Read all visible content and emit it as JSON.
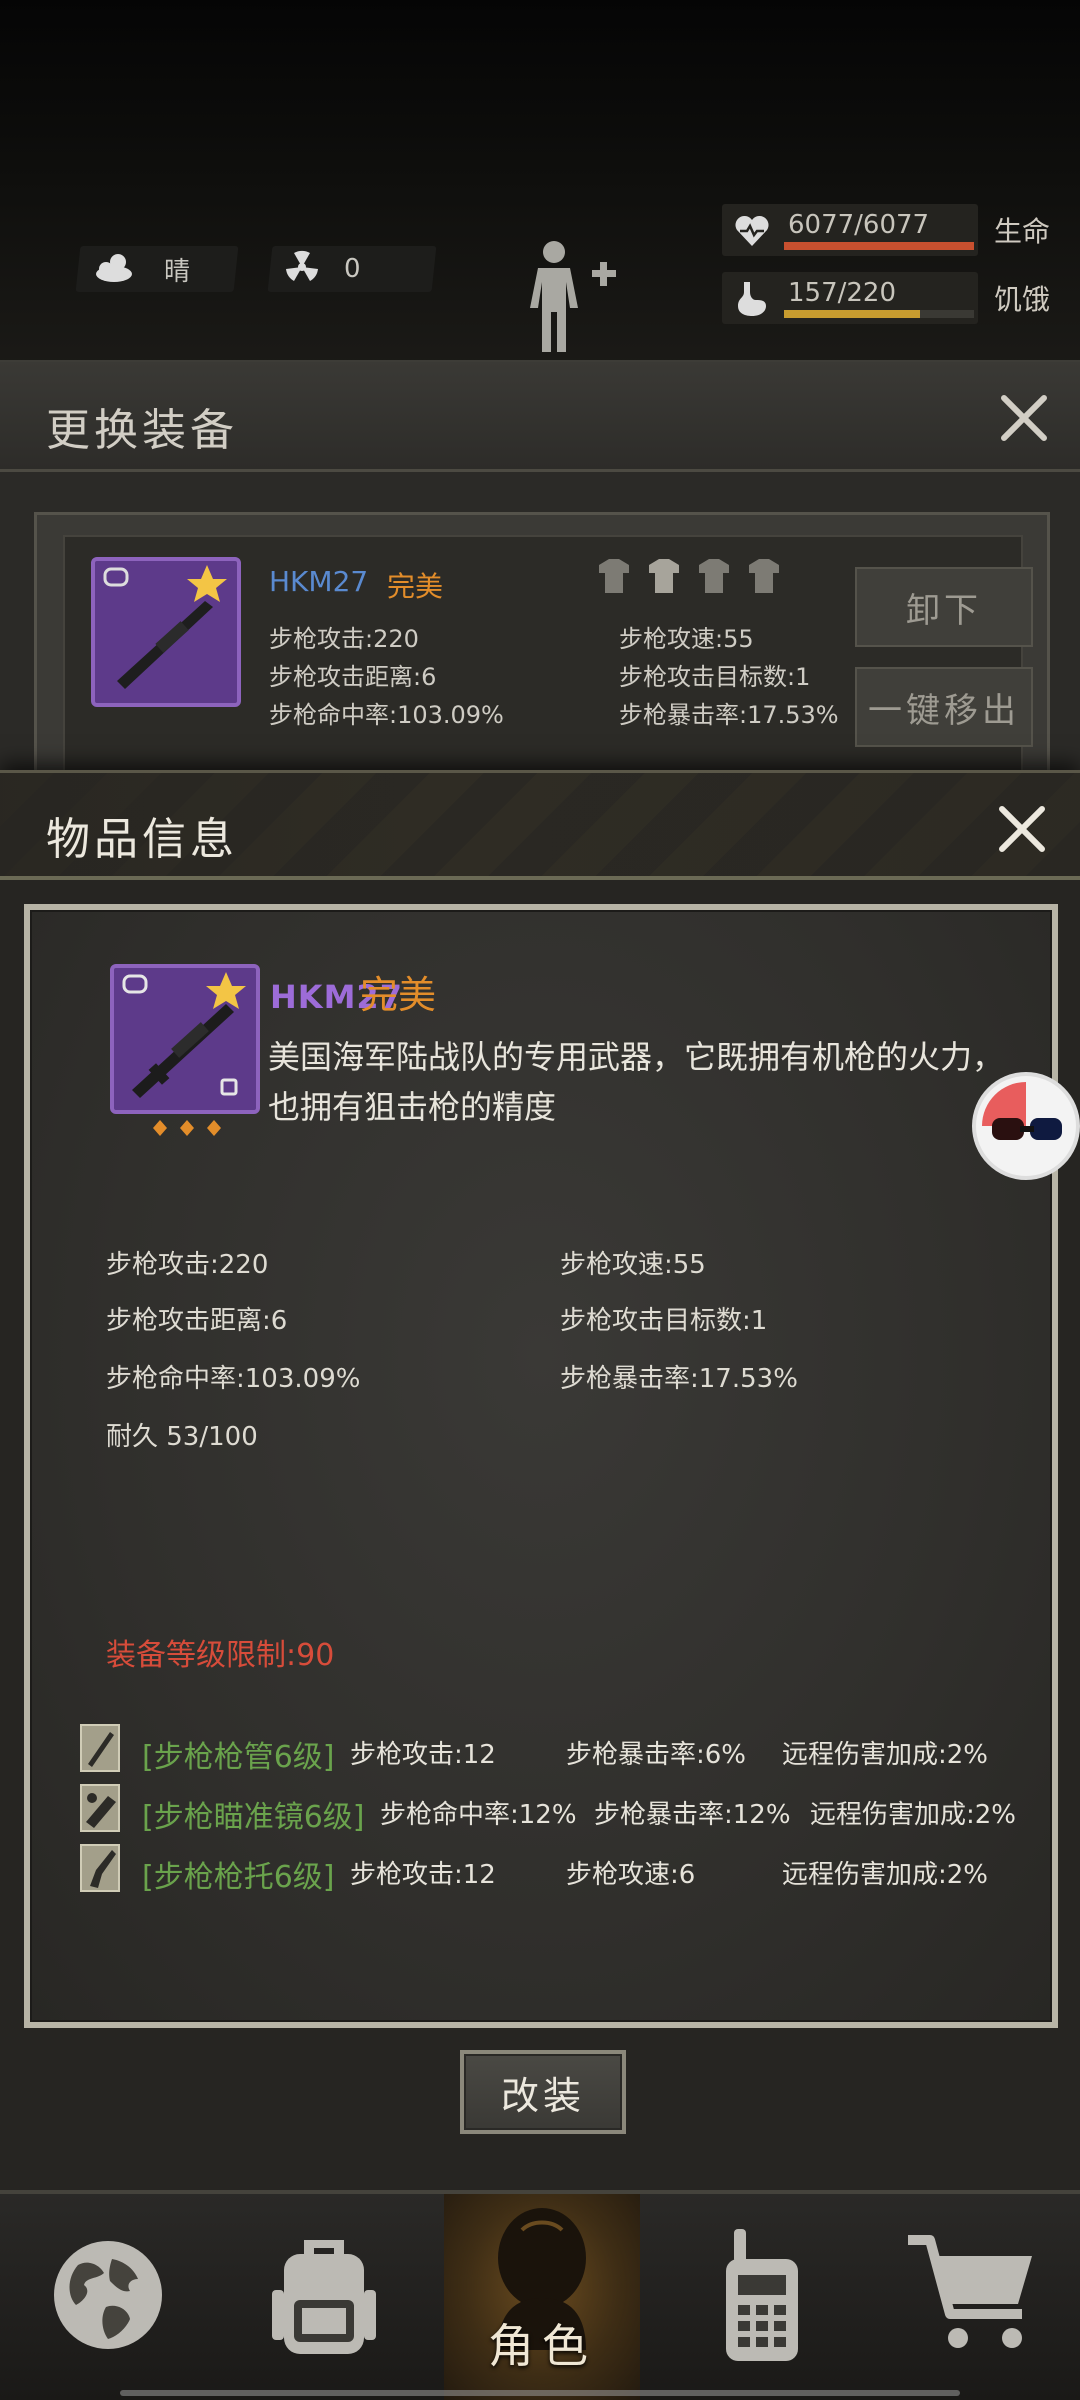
{
  "hud": {
    "weather": "晴",
    "radiation": "0",
    "health": {
      "value": "6077/6077",
      "label": "生命",
      "fill": 1.0,
      "color": "#c8502f"
    },
    "hunger": {
      "value": "157/220",
      "label": "饥饿",
      "fill": 0.714,
      "color": "#c89c2f"
    }
  },
  "equip_panel": {
    "title": "更换装备",
    "item_name": "HKM27",
    "item_quality": "完美",
    "stats": [
      "步枪攻击:220",
      "步枪攻速:55",
      "步枪攻击距离:6",
      "步枪攻击目标数:1",
      "步枪命中率:103.09%",
      "步枪暴击率:17.53%"
    ],
    "unequip_label": "卸下",
    "remove_all_label": "一键移出"
  },
  "modal": {
    "title": "物品信息",
    "item": {
      "name": "HKM27",
      "quality": "完美",
      "description": "美国海军陆战队的专用武器，它既拥有机枪的火力，也拥有狙击枪的精度"
    },
    "stats": {
      "attack": "步枪攻击:220",
      "speed": "步枪攻速:55",
      "range": "步枪攻击距离:6",
      "targets": "步枪攻击目标数:1",
      "accuracy": "步枪命中率:103.09%",
      "crit": "步枪暴击率:17.53%",
      "durability": "耐久 53/100"
    },
    "level_limit": "装备等级限制:90",
    "mods": [
      {
        "name": "[步枪枪管6级]",
        "stats": [
          "步枪攻击:12",
          "步枪暴击率:6%",
          "远程伤害加成:2%"
        ]
      },
      {
        "name": "[步枪瞄准镜6级]",
        "stats": [
          "步枪命中率:12%",
          "步枪暴击率:12%",
          "远程伤害加成:2%"
        ]
      },
      {
        "name": "[步枪枪托6级]",
        "stats": [
          "步枪攻击:12",
          "步枪攻速:6",
          "远程伤害加成:2%"
        ]
      }
    ],
    "modify_label": "改装"
  },
  "nav": {
    "items": [
      {
        "icon": "globe-icon"
      },
      {
        "icon": "backpack-icon"
      },
      {
        "icon": "character-icon",
        "label": "角色"
      },
      {
        "icon": "radio-icon"
      },
      {
        "icon": "cart-icon"
      }
    ]
  }
}
